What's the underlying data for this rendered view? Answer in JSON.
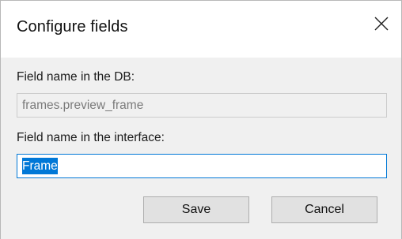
{
  "dialog": {
    "title": "Configure fields",
    "close_icon": "close-icon"
  },
  "db_field": {
    "label": "Field name in the DB:",
    "value": "frames.preview_frame",
    "state": "disabled"
  },
  "interface_field": {
    "label": "Field name in the interface:",
    "value": "Frame",
    "state": "focused, text selected"
  },
  "buttons": {
    "save_label": "Save",
    "cancel_label": "Cancel"
  },
  "colors": {
    "accent": "#0078d7",
    "client_background": "#f0f0f0",
    "button_background": "#e1e1e1",
    "disabled_text": "#7a7a7a"
  }
}
